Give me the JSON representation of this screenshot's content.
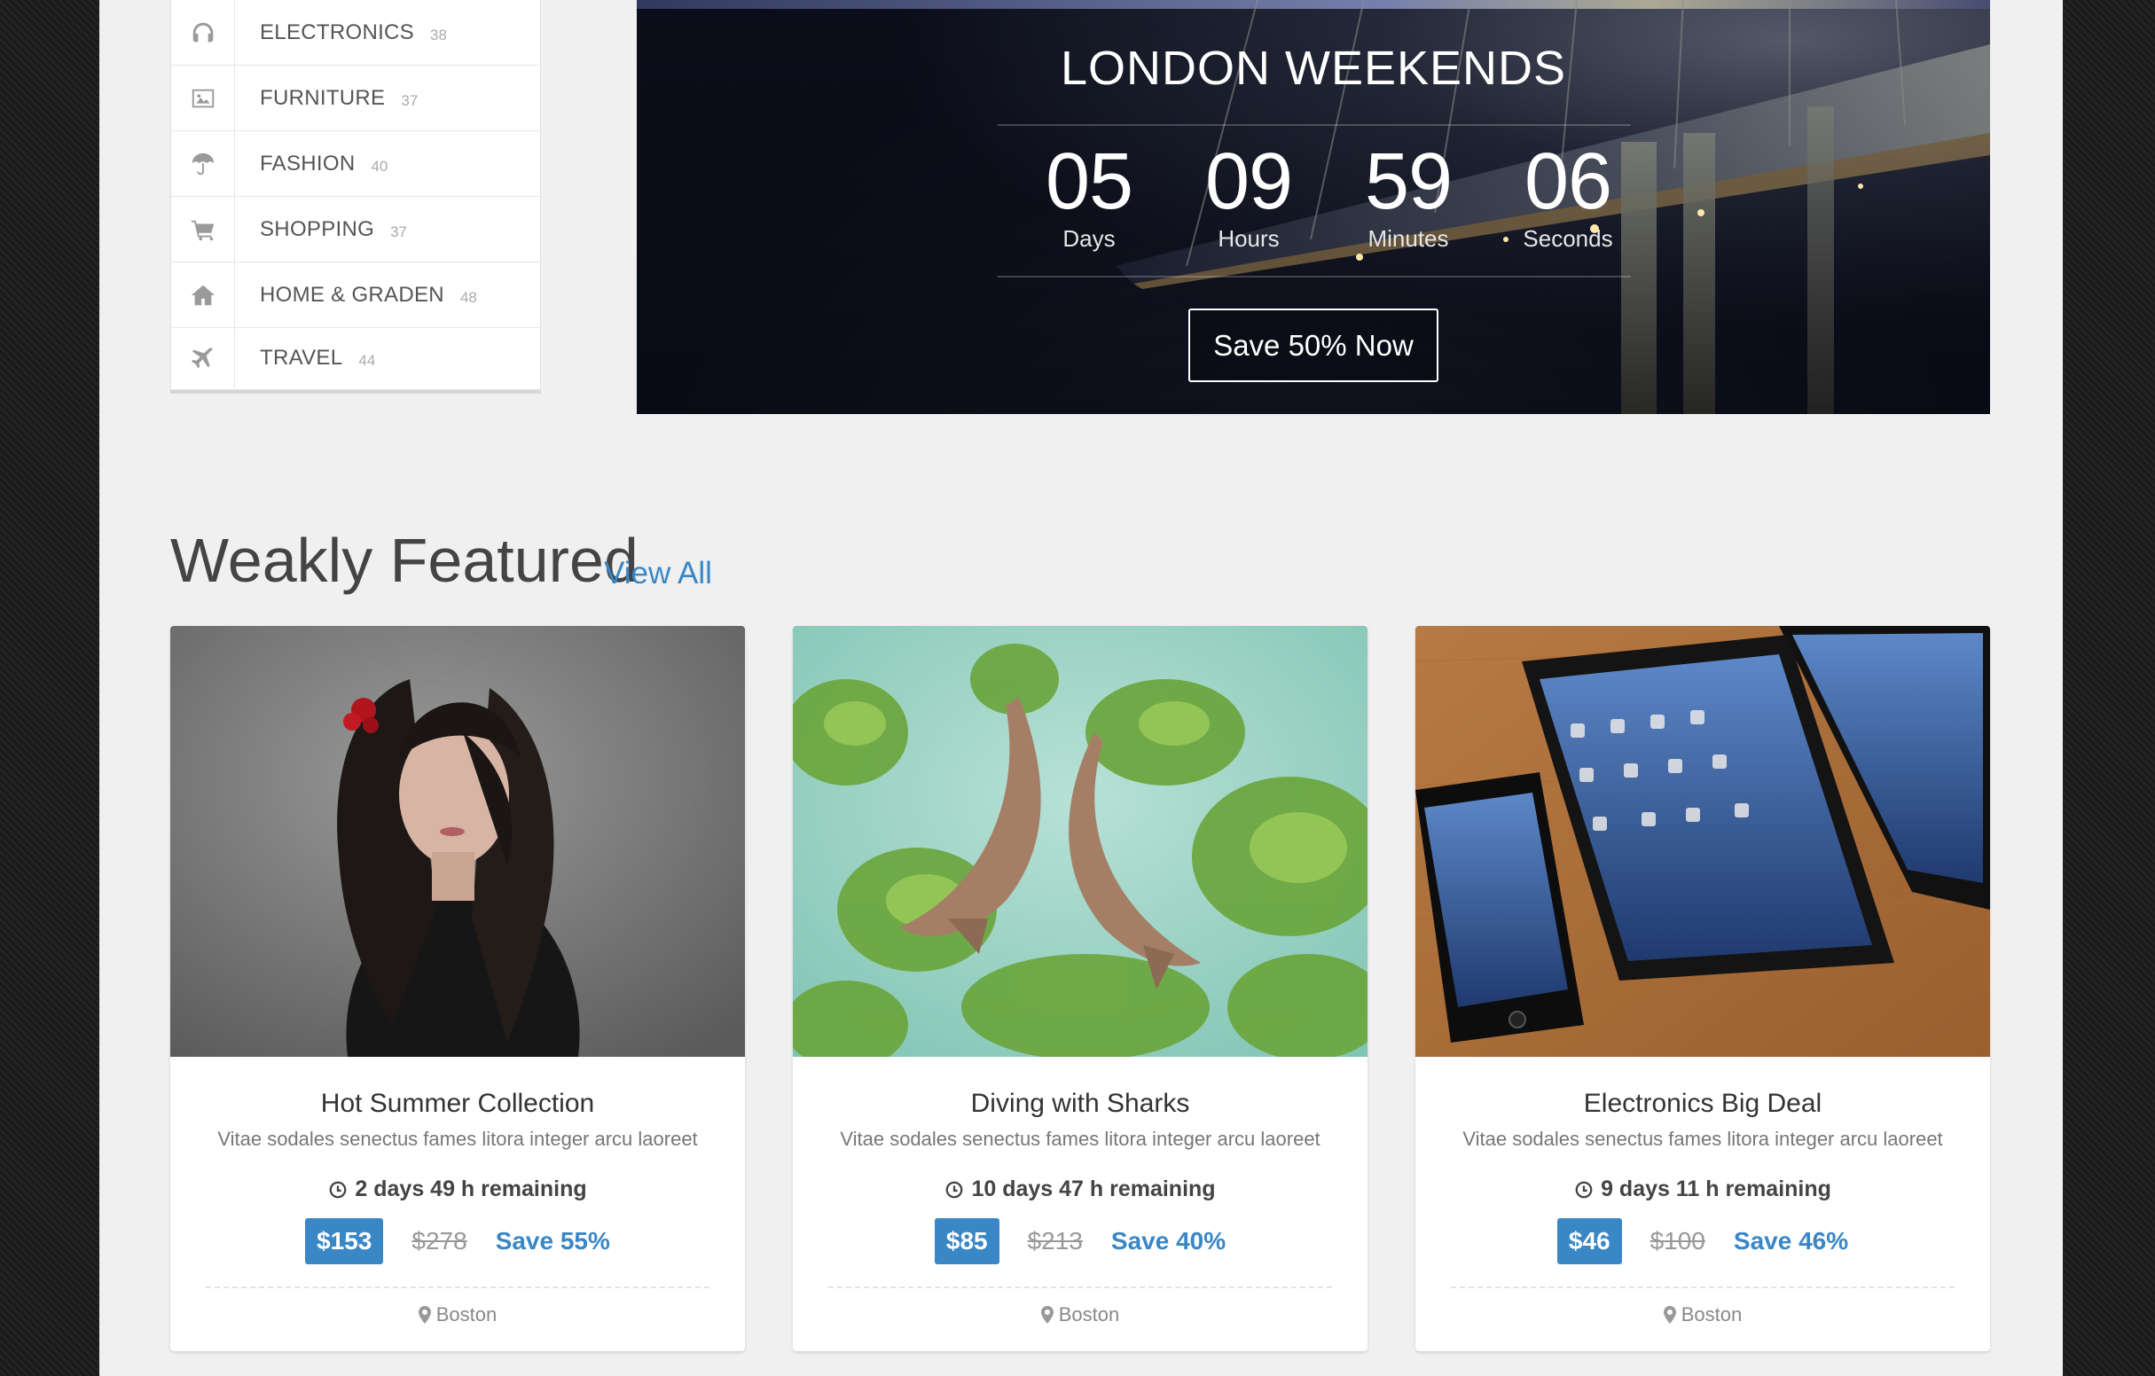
{
  "sidebar": {
    "categories": [
      {
        "label": "ELECTRONICS",
        "count": "38",
        "icon": "headphones-icon"
      },
      {
        "label": "FURNITURE",
        "count": "37",
        "icon": "picture-icon"
      },
      {
        "label": "FASHION",
        "count": "40",
        "icon": "umbrella-icon"
      },
      {
        "label": "SHOPPING",
        "count": "37",
        "icon": "cart-icon"
      },
      {
        "label": "HOME & GRADEN",
        "count": "48",
        "icon": "home-icon"
      },
      {
        "label": "TRAVEL",
        "count": "44",
        "icon": "plane-icon"
      }
    ]
  },
  "hero": {
    "title": "LONDON WEEKENDS",
    "countdown": [
      {
        "value": "05",
        "label": "Days"
      },
      {
        "value": "09",
        "label": "Hours"
      },
      {
        "value": "59",
        "label": "Minutes"
      },
      {
        "value": "06",
        "label": "Seconds"
      }
    ],
    "button": "Save 50% Now"
  },
  "featured": {
    "title": "Weakly Featured",
    "view_all": "View All",
    "cards": [
      {
        "title": "Hot Summer Collection",
        "desc": "Vitae sodales senectus fames litora integer arcu laoreet",
        "remaining": "2 days 49 h remaining",
        "price": "$153",
        "old_price": "$278",
        "save": "Save 55%",
        "location": "Boston",
        "image": "woman-portrait"
      },
      {
        "title": "Diving with Sharks",
        "desc": "Vitae sodales senectus fames litora integer arcu laoreet",
        "remaining": "10 days 47 h remaining",
        "price": "$85",
        "old_price": "$213",
        "save": "Save 40%",
        "location": "Boston",
        "image": "sharks-reef"
      },
      {
        "title": "Electronics Big Deal",
        "desc": "Vitae sodales senectus fames litora integer arcu laoreet",
        "remaining": "9 days 11 h remaining",
        "price": "$46",
        "old_price": "$100",
        "save": "Save 46%",
        "location": "Boston",
        "image": "ipad-iphone"
      }
    ]
  },
  "colors": {
    "accent": "#3a87c6",
    "page_bg": "#f0f0f0",
    "outer_bg": "#1c1c1c"
  }
}
